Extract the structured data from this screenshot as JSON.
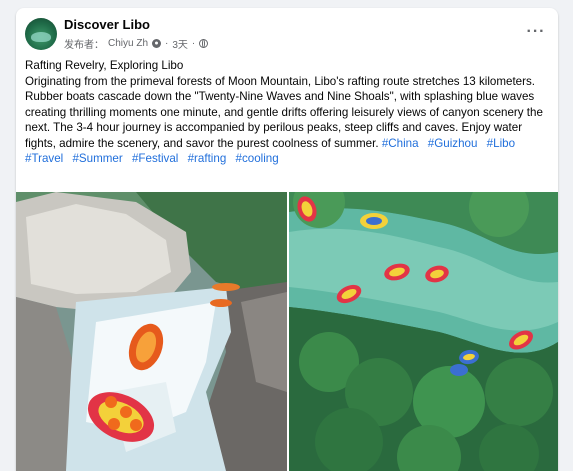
{
  "post": {
    "page_name": "Discover Libo",
    "posted_by_label": "发布者：",
    "author": "Chiyu Zh",
    "time": "3天",
    "more_label": "···",
    "title": "Rafting Revelry, Exploring Libo",
    "body": "Originating from the primeval forests of Moon Mountain, Libo's rafting route stretches 13 kilometers. Rubber boats cascade down the \"Twenty-Nine Waves and Nine Shoals\", with splashing blue waves creating thrilling moments one minute, and gentle drifts offering leisurely views of canyon scenery the next. The 3-4 hour journey is accompanied by perilous peaks, steep cliffs and caves. Enjoy water fights, admire the scenery, and savor the purest coolness of summer.",
    "hashtags": [
      "#China",
      "#Guizhou",
      "#Libo",
      "#Travel",
      "#Summer",
      "#Festival",
      "#rafting",
      "#cooling"
    ]
  },
  "colors": {
    "link": "#216fdb",
    "meta": "#65676b",
    "background": "#f0f2f5"
  },
  "icons": [
    "more-icon",
    "privacy-icon",
    "globe-icon"
  ]
}
